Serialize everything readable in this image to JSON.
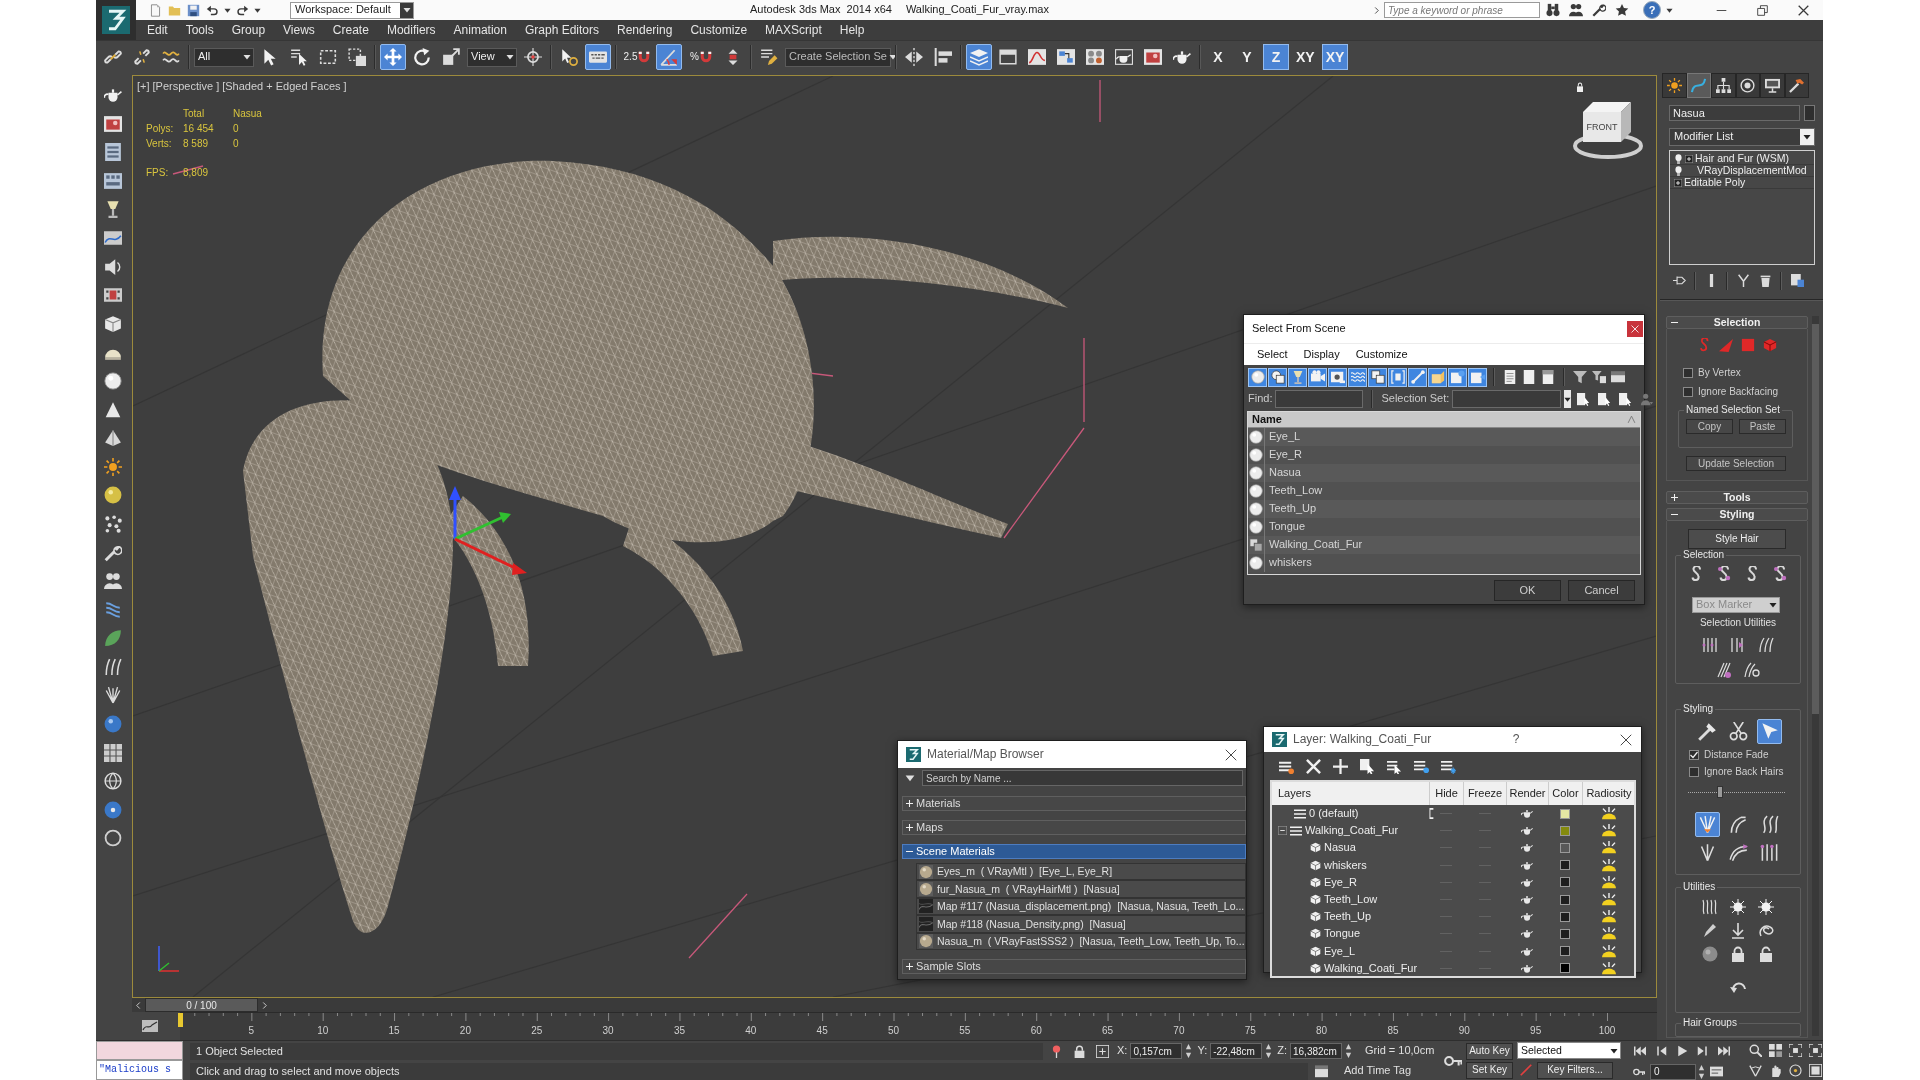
{
  "title_bar": {
    "workspace": "Workspace: Default",
    "app_title": "Autodesk 3ds Max  2014 x64",
    "file_name": "Walking_Coati_Fur_vray.max",
    "search": {
      "placeholder": "Type a keyword or phrase"
    },
    "help_button": "?"
  },
  "menu": [
    "Edit",
    "Tools",
    "Group",
    "Views",
    "Create",
    "Modifiers",
    "Animation",
    "Graph Editors",
    "Rendering",
    "Customize",
    "MAXScript",
    "Help"
  ],
  "main_toolbar": [
    [
      {
        "kind": "icon",
        "selected": false
      },
      {
        "kind": "icon",
        "selected": false
      },
      {
        "kind": "icon",
        "selected": false
      }
    ],
    [
      {
        "kind": "dropdown",
        "value": "All"
      },
      {
        "kind": "icon",
        "selected": false
      },
      {
        "kind": "icon",
        "selected": false
      },
      {
        "kind": "icon",
        "selected": false
      },
      {
        "kind": "icon",
        "selected": false
      }
    ],
    [
      {
        "kind": "icon",
        "selected": true
      },
      {
        "kind": "icon",
        "selected": false
      },
      {
        "kind": "icon",
        "selected": false
      },
      {
        "kind": "dropdown",
        "value": "View"
      },
      {
        "kind": "icon",
        "selected": false
      }
    ],
    [
      {
        "kind": "icon",
        "selected": false
      },
      {
        "kind": "icon",
        "selected": true
      }
    ],
    [
      {
        "kind": "icon",
        "label": "2.5",
        "selected": false
      },
      {
        "kind": "icon",
        "selected": true
      },
      {
        "kind": "icon",
        "label": "%",
        "selected": false
      },
      {
        "kind": "icon",
        "selected": false
      }
    ],
    [
      {
        "kind": "icon",
        "selected": false
      },
      {
        "kind": "dropdown",
        "value": "Create Selection Se"
      }
    ],
    [
      {
        "kind": "icon",
        "selected": false
      },
      {
        "kind": "icon",
        "selected": false
      }
    ],
    [
      {
        "kind": "icon",
        "selected": true
      },
      {
        "kind": "icon",
        "selected": false
      },
      {
        "kind": "icon",
        "selected": false
      },
      {
        "kind": "icon",
        "selected": false
      },
      {
        "kind": "icon",
        "selected": false
      },
      {
        "kind": "icon",
        "selected": false
      },
      {
        "kind": "icon",
        "selected": false
      },
      {
        "kind": "icon",
        "selected": false
      }
    ],
    [
      {
        "kind": "axis",
        "label": "X",
        "selected": false
      },
      {
        "kind": "axis",
        "label": "Y",
        "selected": false
      },
      {
        "kind": "axis",
        "label": "Z",
        "selected": true
      },
      {
        "kind": "axis",
        "label": "XY",
        "selected": false
      },
      {
        "kind": "axis",
        "label": "XY",
        "selected": true
      }
    ]
  ],
  "viewport": {
    "labels": [
      "[+]",
      "[Perspective ]",
      "[Shaded + Edged Faces ]"
    ],
    "stats": {
      "columns": [
        "Total",
        "Nasua"
      ],
      "rows": [
        {
          "label": "Polys:",
          "values": [
            "16 454",
            "0"
          ]
        },
        {
          "label": "Verts:",
          "values": [
            "8 589",
            "0"
          ]
        }
      ]
    },
    "fps": {
      "label": "FPS:",
      "value": "8,809"
    },
    "view_cube": "FRONT"
  },
  "select_from_scene": {
    "title": "Select From Scene",
    "menu": [
      "Select",
      "Display",
      "Customize"
    ],
    "filters": [
      {
        "on": true
      },
      {
        "on": true
      },
      {
        "on": true
      },
      {
        "on": true
      },
      {
        "on": true
      },
      {
        "on": true
      },
      {
        "on": true
      },
      {
        "on": true
      },
      {
        "on": true
      },
      {
        "on": true
      },
      {
        "on": true
      },
      {
        "on": true
      }
    ],
    "find_label": "Find:",
    "selection_set_label": "Selection Set:",
    "column": "Name",
    "objects": [
      {
        "name": "Eye_L",
        "kind": "geometry",
        "selected": false
      },
      {
        "name": "Eye_R",
        "kind": "geometry",
        "selected": false
      },
      {
        "name": "Nasua",
        "kind": "geometry",
        "selected": false
      },
      {
        "name": "Teeth_Low",
        "kind": "geometry",
        "selected": false
      },
      {
        "name": "Teeth_Up",
        "kind": "geometry",
        "selected": false
      },
      {
        "name": "Tongue",
        "kind": "geometry",
        "selected": false
      },
      {
        "name": "Walking_Coati_Fur",
        "kind": "group",
        "selected": false
      },
      {
        "name": "whiskers",
        "kind": "geometry",
        "selected": false
      }
    ],
    "buttons": [
      "OK",
      "Cancel"
    ]
  },
  "material_browser": {
    "title": "Material/Map Browser",
    "search": {
      "placeholder": "Search by Name ..."
    },
    "groups": [
      {
        "label": "Materials",
        "expanded": false,
        "selected": false
      },
      {
        "label": "Maps",
        "expanded": false,
        "selected": false
      },
      {
        "label": "Scene Materials",
        "expanded": true,
        "selected": true,
        "items": [
          {
            "kind": "material",
            "text": "Eyes_m  ( VRayMtl )  [Eye_L, Eye_R]"
          },
          {
            "kind": "material",
            "text": "fur_Nasua_m  ( VRayHairMtl )  [Nasua]"
          },
          {
            "kind": "map",
            "text": "Map #117 (Nasua_displacement.png)  [Nasua, Nasua, Teeth_Lo..."
          },
          {
            "kind": "map",
            "text": "Map #118 (Nasua_Density.png)  [Nasua]"
          },
          {
            "kind": "material",
            "text": "Nasua_m  ( VRayFastSSS2 )  [Nasua, Teeth_Low, Teeth_Up, To..."
          }
        ]
      },
      {
        "label": "Sample Slots",
        "expanded": false,
        "selected": false
      }
    ]
  },
  "layer_dialog": {
    "title": "Layer: Walking_Coati_Fur",
    "help_button": "?",
    "columns": [
      "Layers",
      "Hide",
      "Freeze",
      "Render",
      "Color",
      "Radiosity"
    ],
    "layers": [
      {
        "name": "0 (default)",
        "current": true,
        "hidden": false,
        "frozen": false,
        "color": "#e4e6a4"
      },
      {
        "name": "Walking_Coati_Fur",
        "current": false,
        "expanded": true,
        "hidden": false,
        "frozen": false,
        "color": "#848a0e",
        "children": [
          {
            "name": "Nasua",
            "hidden": false,
            "frozen": false,
            "color": "#585858"
          },
          {
            "name": "whiskers",
            "hidden": false,
            "frozen": false,
            "color": "#1e1e1e"
          },
          {
            "name": "Eye_R",
            "hidden": false,
            "frozen": false,
            "color": "#1e1e1e"
          },
          {
            "name": "Teeth_Low",
            "hidden": false,
            "frozen": false,
            "color": "#1e1e1e"
          },
          {
            "name": "Teeth_Up",
            "hidden": false,
            "frozen": false,
            "color": "#1e1e1e"
          },
          {
            "name": "Tongue",
            "hidden": false,
            "frozen": false,
            "color": "#1e1e1e"
          },
          {
            "name": "Eye_L",
            "hidden": false,
            "frozen": false,
            "color": "#1e1e1e"
          },
          {
            "name": "Walking_Coati_Fur",
            "hidden": false,
            "frozen": false,
            "color": "#000000"
          }
        ]
      }
    ]
  },
  "command_panel": {
    "tabs": [
      {
        "selected": false
      },
      {
        "selected": true
      },
      {
        "selected": false
      },
      {
        "selected": false
      },
      {
        "selected": false
      },
      {
        "selected": false
      }
    ],
    "object_name": "Nasua",
    "modifier_list": "Modifier List",
    "stack": [
      {
        "name": "Hair and Fur (WSM)",
        "kind": "modifier",
        "on": true,
        "expandable": true
      },
      {
        "name": "VRayDisplacementMod",
        "kind": "modifier",
        "on": true,
        "expandable": false
      },
      {
        "name": "Editable Poly",
        "kind": "base",
        "expandable": true
      }
    ],
    "rollouts": [
      {
        "kind": "selection",
        "title": "Selection",
        "expanded": true,
        "modes": [
          {
            "selected": false
          },
          {
            "selected": false
          },
          {
            "selected": false
          },
          {
            "selected": false
          }
        ],
        "checkboxes": [
          {
            "label": "By Vertex",
            "checked": false
          },
          {
            "label": "Ignore Backfacing",
            "checked": false
          }
        ],
        "named_set": {
          "title": "Named Selection Set",
          "buttons": [
            "Copy",
            "Paste"
          ]
        },
        "update_button": "Update Selection"
      },
      {
        "kind": "tools",
        "title": "Tools",
        "expanded": false
      },
      {
        "kind": "styling",
        "title": "Styling",
        "expanded": true,
        "style_button": "Style Hair",
        "selection": {
          "title": "Selection",
          "tools": [
            {
              "selected": false
            },
            {
              "selected": false
            },
            {
              "selected": false
            },
            {
              "selected": false
            }
          ],
          "marker": {
            "value": "Box Marker",
            "disabled": true
          },
          "utilities_label": "Selection Utilities"
        },
        "styling": {
          "title": "Styling",
          "tools": [
            {
              "selected": false
            },
            {
              "selected": false
            },
            {
              "selected": true
            }
          ],
          "checkboxes": [
            {
              "label": "Distance Fade",
              "checked": true
            },
            {
              "label": "Ignore Back Hairs",
              "checked": false
            }
          ],
          "slider": {
            "level": 0.32
          },
          "brushes": [
            {
              "selected": true
            },
            {
              "selected": false
            },
            {
              "selected": false
            },
            {
              "selected": false
            },
            {
              "selected": false
            },
            {
              "selected": false
            }
          ]
        },
        "utilities": {
          "title": "Utilities"
        },
        "hair_groups": {
          "title": "Hair Groups"
        }
      }
    ]
  },
  "timeline": {
    "slider": {
      "label": "0 / 100",
      "level": 0
    },
    "ticks": [
      "5",
      "10",
      "15",
      "20",
      "25",
      "30",
      "35",
      "40",
      "45",
      "50",
      "55",
      "60",
      "65",
      "70",
      "75",
      "80",
      "85",
      "90",
      "95",
      "100"
    ]
  },
  "status_bar": {
    "listener": "\"Malicious s",
    "selection": "1 Object Selected",
    "prompt": "Click and drag to select and move objects",
    "coordinates": [
      {
        "axis": "X:",
        "value": "0,157cm"
      },
      {
        "axis": "Y:",
        "value": "-22,48cm"
      },
      {
        "axis": "Z:",
        "value": "16,382cm"
      }
    ],
    "grid": "Grid = 10,0cm",
    "time_tag": "Add Time Tag",
    "auto_key": {
      "label": "Auto Key",
      "on": false
    },
    "set_key": "Set Key",
    "key_mode": "Selected",
    "key_filters": "Key Filters...",
    "frame": "0"
  }
}
